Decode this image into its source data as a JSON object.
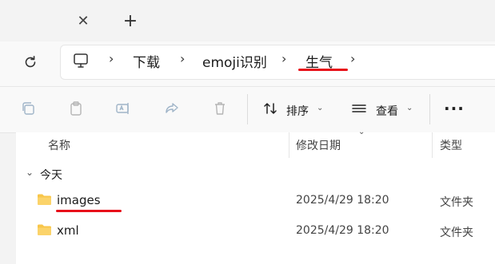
{
  "tabs": {
    "close_glyph": "✕",
    "add_glyph": "+"
  },
  "address": {
    "icons": [
      "refresh-icon",
      "computer-icon"
    ],
    "crumbs": [
      "下载",
      "emoji识别",
      "生气"
    ],
    "chevron": "›"
  },
  "toolbar": {
    "icons": [
      "copy-icon",
      "paste-icon",
      "rename-icon",
      "share-icon",
      "delete-icon",
      "sort-icon",
      "view-icon",
      "more-icon"
    ],
    "sort_label": "排序",
    "view_label": "查看",
    "more_label": "···",
    "caret": "⌄"
  },
  "columns": {
    "name": "名称",
    "modified": "修改日期",
    "type": "类型"
  },
  "group": {
    "label": "今天",
    "toggle": "⌄"
  },
  "files": [
    {
      "name": "images",
      "modified": "2025/4/29 18:20",
      "type": "文件夹"
    },
    {
      "name": "xml",
      "modified": "2025/4/29 18:20",
      "type": "文件夹"
    }
  ],
  "colors": {
    "annotation_red": "#e8101a",
    "folder_yellow": "#f8c64a"
  }
}
